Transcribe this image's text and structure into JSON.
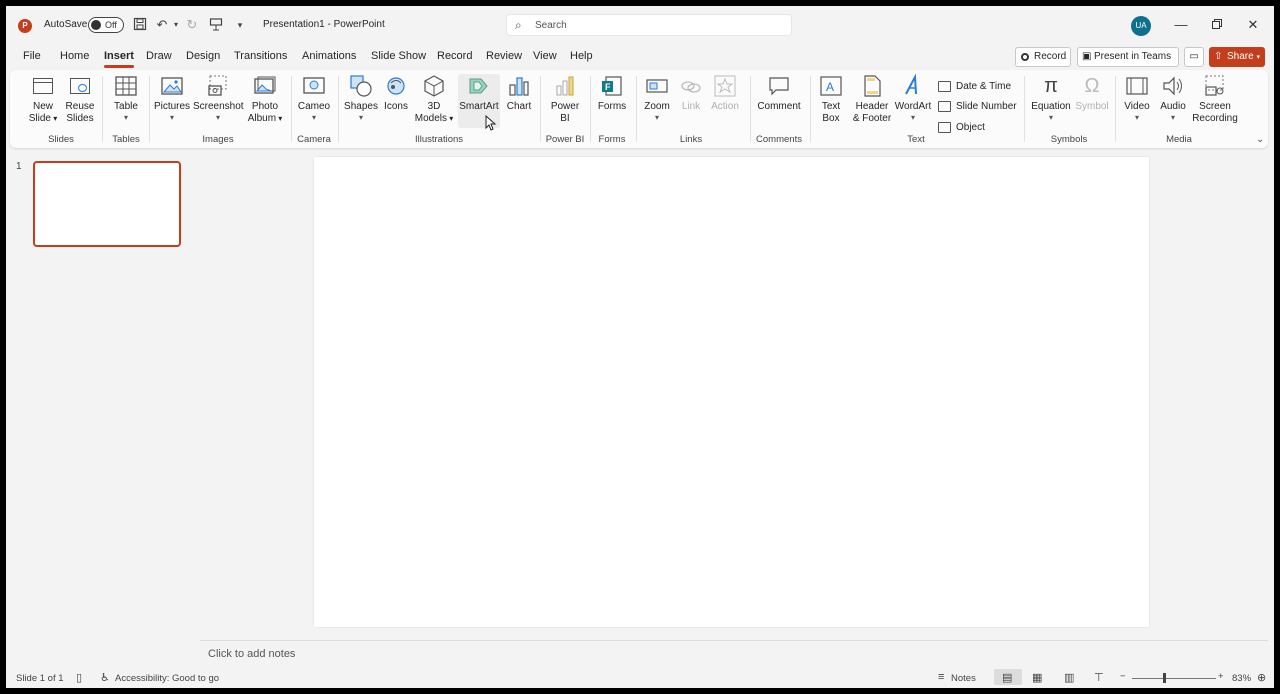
{
  "titlebar": {
    "logo": "P",
    "autosave_label": "AutoSave",
    "autosave_state": "Off",
    "doc_title": "Presentation1  -  PowerPoint",
    "search_placeholder": "Search",
    "avatar_initials": "UA",
    "icons": [
      "save-icon",
      "undo-icon",
      "redo-icon",
      "present-icon",
      "customize-qat-icon",
      "minimize-icon",
      "restore-icon",
      "close-icon"
    ]
  },
  "tabs": [
    "File",
    "Home",
    "Insert",
    "Draw",
    "Design",
    "Transitions",
    "Animations",
    "Slide Show",
    "Record",
    "Review",
    "View",
    "Help"
  ],
  "active_tab": "Insert",
  "header_buttons": {
    "record": "Record",
    "present_teams": "Present in Teams",
    "share": "Share"
  },
  "ribbon": {
    "slides": {
      "label": "Slides",
      "new_slide": [
        "New",
        "Slide"
      ],
      "reuse": [
        "Reuse",
        "Slides"
      ]
    },
    "tables": {
      "label": "Tables",
      "table": "Table"
    },
    "images": {
      "label": "Images",
      "pictures": "Pictures",
      "screenshot": "Screenshot",
      "album": [
        "Photo",
        "Album"
      ]
    },
    "camera": {
      "label": "Camera",
      "cameo": "Cameo"
    },
    "illustrations": {
      "label": "Illustrations",
      "shapes": "Shapes",
      "icons": "Icons",
      "models": [
        "3D",
        "Models"
      ],
      "smartart": "SmartArt",
      "chart": "Chart"
    },
    "powerbi": {
      "label": "Power BI",
      "btn": [
        "Power",
        "BI"
      ]
    },
    "forms": {
      "label": "Forms",
      "btn": "Forms"
    },
    "links": {
      "label": "Links",
      "zoom": "Zoom",
      "link": "Link",
      "action": "Action"
    },
    "comments": {
      "label": "Comments",
      "comment": "Comment"
    },
    "text": {
      "label": "Text",
      "textbox": [
        "Text",
        "Box"
      ],
      "header": [
        "Header",
        "& Footer"
      ],
      "wordart": "WordArt",
      "datetime": "Date & Time",
      "slidenum": "Slide Number",
      "object": "Object"
    },
    "symbols": {
      "label": "Symbols",
      "equation": "Equation",
      "symbol": "Symbol"
    },
    "media": {
      "label": "Media",
      "video": "Video",
      "audio": "Audio",
      "screenrec": [
        "Screen",
        "Recording"
      ]
    }
  },
  "thumbnails": [
    {
      "number": "1"
    }
  ],
  "notes_placeholder": "Click to add notes",
  "status": {
    "slide_of": "Slide 1 of 1",
    "accessibility": "Accessibility: Good to go",
    "notes": "Notes",
    "zoom_percent": "83%",
    "zoom_level": 0.83
  },
  "colors": {
    "accent": "#c43e1c",
    "icon_blue": "#2b7cd3",
    "avatar": "#0f6f8f"
  }
}
